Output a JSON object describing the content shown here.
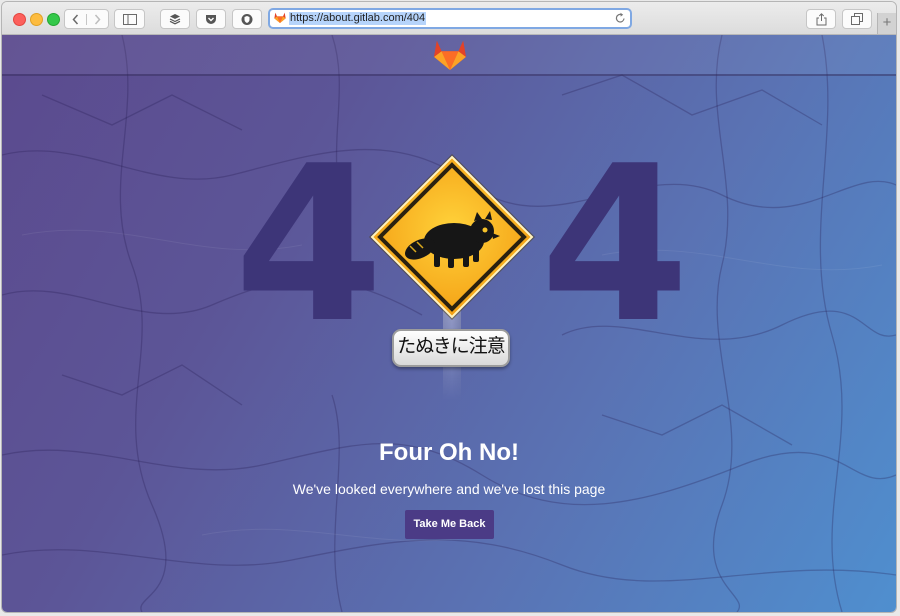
{
  "browser": {
    "url": "https://about.gitlab.com/404",
    "new_tab_symbol": "+"
  },
  "sign": {
    "plate_text": "たぬきに注意"
  },
  "error": {
    "digit_left": "4",
    "digit_right": "4",
    "headline": "Four Oh No!",
    "message": "We've looked everywhere and we've lost this page",
    "button_label": "Take Me Back"
  },
  "colors": {
    "gitlab_orange": "#fc6d26",
    "button_purple": "#4b3b86",
    "digit_purple": "#3d3578",
    "sign_yellow": "#f9b51e"
  },
  "icons": {
    "sidebar": "sidebar-icon",
    "layers": "layers-icon",
    "pocket": "pocket-icon",
    "extension": "shield-icon",
    "share": "share-icon",
    "tabs": "tabs-icon",
    "reload": "reload-icon",
    "logo": "gitlab-tanuki-icon"
  }
}
